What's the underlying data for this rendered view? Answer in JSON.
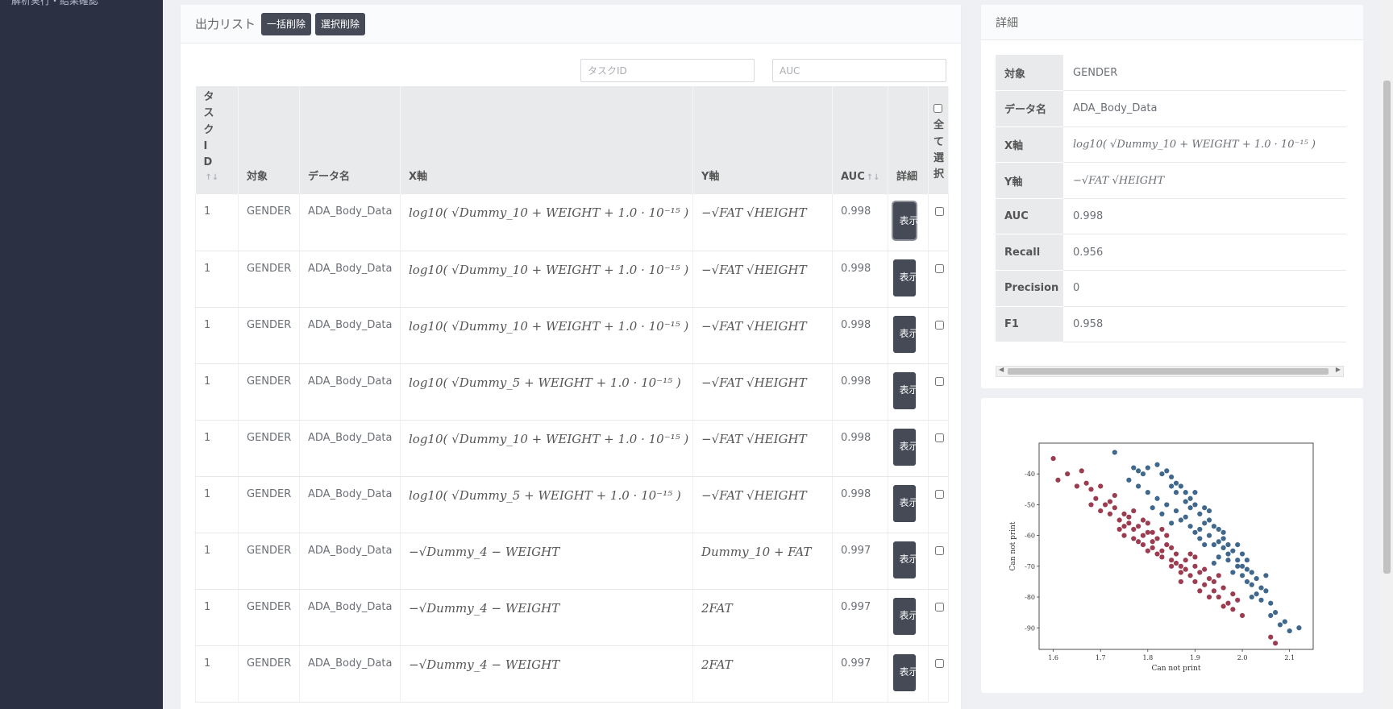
{
  "sidebar": {
    "item_label": "解析実行・結果確認"
  },
  "output_list": {
    "title": "出力リスト",
    "bulk_delete_label": "一括削除",
    "selected_delete_label": "選択削除",
    "filter_task_placeholder": "タスクID",
    "filter_auc_placeholder": "AUC",
    "columns": {
      "task_id": "タスクID",
      "target": "対象",
      "data_name": "データ名",
      "x_axis": "X軸",
      "y_axis": "Y軸",
      "auc": "AUC",
      "detail": "詳細",
      "select_all": "全て選択"
    },
    "sort_icon": "sort-arrows-icon",
    "show_label": "表示",
    "rows": [
      {
        "task_id": "1",
        "target": "GENDER",
        "data_name": "ADA_Body_Data",
        "x": "log10( √Dummy_10 + WEIGHT + 1.0 · 10⁻¹⁵ )",
        "y": "−√FAT √HEIGHT",
        "auc": "0.998"
      },
      {
        "task_id": "1",
        "target": "GENDER",
        "data_name": "ADA_Body_Data",
        "x": "log10( √Dummy_10 + WEIGHT + 1.0 · 10⁻¹⁵ )",
        "y": "−√FAT √HEIGHT",
        "auc": "0.998"
      },
      {
        "task_id": "1",
        "target": "GENDER",
        "data_name": "ADA_Body_Data",
        "x": "log10( √Dummy_10 + WEIGHT + 1.0 · 10⁻¹⁵ )",
        "y": "−√FAT √HEIGHT",
        "auc": "0.998"
      },
      {
        "task_id": "1",
        "target": "GENDER",
        "data_name": "ADA_Body_Data",
        "x": "log10( √Dummy_5 + WEIGHT + 1.0 · 10⁻¹⁵ )",
        "y": "−√FAT √HEIGHT",
        "auc": "0.998"
      },
      {
        "task_id": "1",
        "target": "GENDER",
        "data_name": "ADA_Body_Data",
        "x": "log10( √Dummy_10 + WEIGHT + 1.0 · 10⁻¹⁵ )",
        "y": "−√FAT √HEIGHT",
        "auc": "0.998"
      },
      {
        "task_id": "1",
        "target": "GENDER",
        "data_name": "ADA_Body_Data",
        "x": "log10( √Dummy_5 + WEIGHT + 1.0 · 10⁻¹⁵ )",
        "y": "−√FAT √HEIGHT",
        "auc": "0.998"
      },
      {
        "task_id": "1",
        "target": "GENDER",
        "data_name": "ADA_Body_Data",
        "x": "−√Dummy_4 − WEIGHT",
        "y": "Dummy_10 + FAT",
        "auc": "0.997"
      },
      {
        "task_id": "1",
        "target": "GENDER",
        "data_name": "ADA_Body_Data",
        "x": "−√Dummy_4 − WEIGHT",
        "y": "2FAT",
        "auc": "0.997"
      },
      {
        "task_id": "1",
        "target": "GENDER",
        "data_name": "ADA_Body_Data",
        "x": "−√Dummy_4 − WEIGHT",
        "y": "2FAT",
        "auc": "0.997"
      }
    ]
  },
  "detail": {
    "title": "詳細",
    "rows": [
      {
        "label": "対象",
        "value": "GENDER"
      },
      {
        "label": "データ名",
        "value": "ADA_Body_Data"
      },
      {
        "label": "X軸",
        "value": "log10( √Dummy_10 + WEIGHT + 1.0 · 10⁻¹⁵ )"
      },
      {
        "label": "Y軸",
        "value": "−√FAT √HEIGHT"
      },
      {
        "label": "AUC",
        "value": "0.998"
      },
      {
        "label": "Recall",
        "value": "0.956"
      },
      {
        "label": "Precision",
        "value": "0"
      },
      {
        "label": "F1",
        "value": "0.958"
      }
    ]
  },
  "chart_data": {
    "type": "scatter",
    "title": "",
    "xlabel": "Can not print",
    "ylabel": "Can not print",
    "xlim": [
      1.57,
      2.15
    ],
    "ylim": [
      -97,
      -30
    ],
    "xticks": [
      1.6,
      1.7,
      1.8,
      1.9,
      2.0,
      2.1
    ],
    "xtick_labels": [
      "1.6",
      "1.7",
      "1.8",
      "1.9",
      "2.0",
      "2.1"
    ],
    "yticks": [
      -40,
      -50,
      -60,
      -70,
      -80,
      -90
    ],
    "ytick_labels": [
      "-40",
      "-50",
      "-60",
      "-70",
      "-80",
      "-90"
    ],
    "grid": false,
    "legend": "none",
    "colors": {
      "class_a": "#1f4e79",
      "class_b": "#8b1a32"
    },
    "series": [
      {
        "color_key": "class_a",
        "points": [
          [
            1.73,
            -33
          ],
          [
            1.77,
            -38
          ],
          [
            1.79,
            -40
          ],
          [
            1.8,
            -38
          ],
          [
            1.82,
            -37
          ],
          [
            1.83,
            -40
          ],
          [
            1.84,
            -39
          ],
          [
            1.85,
            -41
          ],
          [
            1.85,
            -44
          ],
          [
            1.86,
            -46
          ],
          [
            1.87,
            -44
          ],
          [
            1.88,
            -46
          ],
          [
            1.88,
            -49
          ],
          [
            1.89,
            -48
          ],
          [
            1.9,
            -50
          ],
          [
            1.9,
            -46
          ],
          [
            1.91,
            -53
          ],
          [
            1.92,
            -51
          ],
          [
            1.92,
            -56
          ],
          [
            1.93,
            -55
          ],
          [
            1.94,
            -57
          ],
          [
            1.95,
            -58
          ],
          [
            1.95,
            -62
          ],
          [
            1.96,
            -61
          ],
          [
            1.97,
            -63
          ],
          [
            1.97,
            -66
          ],
          [
            1.98,
            -65
          ],
          [
            1.99,
            -68
          ],
          [
            2.0,
            -66
          ],
          [
            2.0,
            -70
          ],
          [
            2.01,
            -71
          ],
          [
            2.02,
            -72
          ],
          [
            2.02,
            -76
          ],
          [
            2.03,
            -74
          ],
          [
            2.04,
            -77
          ],
          [
            2.05,
            -78
          ],
          [
            2.06,
            -82
          ],
          [
            2.07,
            -85
          ],
          [
            2.08,
            -89
          ],
          [
            2.09,
            -88
          ],
          [
            2.1,
            -91
          ],
          [
            2.12,
            -90
          ],
          [
            1.76,
            -42
          ],
          [
            1.78,
            -44
          ],
          [
            1.8,
            -46
          ],
          [
            1.82,
            -48
          ],
          [
            1.84,
            -50
          ],
          [
            1.86,
            -52
          ],
          [
            1.87,
            -55
          ],
          [
            1.89,
            -57
          ],
          [
            1.9,
            -59
          ],
          [
            1.91,
            -61
          ],
          [
            1.93,
            -60
          ],
          [
            1.94,
            -63
          ],
          [
            1.96,
            -64
          ],
          [
            1.97,
            -68
          ],
          [
            1.99,
            -70
          ],
          [
            2.0,
            -73
          ],
          [
            2.01,
            -75
          ],
          [
            2.03,
            -79
          ],
          [
            1.81,
            -51
          ],
          [
            1.83,
            -53
          ],
          [
            1.85,
            -56
          ],
          [
            1.88,
            -54
          ],
          [
            1.91,
            -58
          ],
          [
            1.95,
            -67
          ],
          [
            1.98,
            -72
          ],
          [
            2.04,
            -81
          ],
          [
            1.78,
            -39
          ],
          [
            1.86,
            -43
          ],
          [
            1.93,
            -52
          ],
          [
            1.96,
            -59
          ],
          [
            1.99,
            -63
          ],
          [
            2.01,
            -68
          ],
          [
            2.05,
            -73
          ],
          [
            2.06,
            -86
          ],
          [
            1.89,
            -51
          ],
          [
            1.92,
            -63
          ],
          [
            1.94,
            -69
          ],
          [
            2.02,
            -80
          ]
        ]
      },
      {
        "color_key": "class_b",
        "points": [
          [
            1.6,
            -35
          ],
          [
            1.61,
            -42
          ],
          [
            1.66,
            -39
          ],
          [
            1.67,
            -43
          ],
          [
            1.68,
            -45
          ],
          [
            1.69,
            -48
          ],
          [
            1.7,
            -44
          ],
          [
            1.71,
            -50
          ],
          [
            1.72,
            -53
          ],
          [
            1.73,
            -51
          ],
          [
            1.74,
            -55
          ],
          [
            1.75,
            -53
          ],
          [
            1.75,
            -57
          ],
          [
            1.76,
            -56
          ],
          [
            1.77,
            -58
          ],
          [
            1.77,
            -61
          ],
          [
            1.78,
            -57
          ],
          [
            1.79,
            -60
          ],
          [
            1.79,
            -63
          ],
          [
            1.8,
            -59
          ],
          [
            1.81,
            -62
          ],
          [
            1.81,
            -64
          ],
          [
            1.82,
            -61
          ],
          [
            1.83,
            -65
          ],
          [
            1.83,
            -67
          ],
          [
            1.84,
            -63
          ],
          [
            1.85,
            -68
          ],
          [
            1.85,
            -70
          ],
          [
            1.86,
            -66
          ],
          [
            1.87,
            -70
          ],
          [
            1.87,
            -72
          ],
          [
            1.88,
            -68
          ],
          [
            1.89,
            -73
          ],
          [
            1.9,
            -70
          ],
          [
            1.9,
            -75
          ],
          [
            1.91,
            -72
          ],
          [
            1.92,
            -76
          ],
          [
            1.93,
            -74
          ],
          [
            1.94,
            -78
          ],
          [
            1.95,
            -80
          ],
          [
            1.96,
            -77
          ],
          [
            1.97,
            -82
          ],
          [
            1.98,
            -84
          ],
          [
            1.99,
            -81
          ],
          [
            2.0,
            -86
          ],
          [
            2.06,
            -93
          ],
          [
            2.07,
            -95
          ],
          [
            1.72,
            -49
          ],
          [
            1.74,
            -58
          ],
          [
            1.76,
            -54
          ],
          [
            1.78,
            -62
          ],
          [
            1.8,
            -56
          ],
          [
            1.82,
            -66
          ],
          [
            1.84,
            -60
          ],
          [
            1.86,
            -69
          ],
          [
            1.88,
            -71
          ],
          [
            1.9,
            -67
          ],
          [
            1.92,
            -71
          ],
          [
            1.94,
            -75
          ],
          [
            1.96,
            -83
          ],
          [
            1.7,
            -52
          ],
          [
            1.73,
            -47
          ],
          [
            1.77,
            -52
          ],
          [
            1.8,
            -65
          ],
          [
            1.83,
            -58
          ],
          [
            1.85,
            -64
          ],
          [
            1.89,
            -66
          ],
          [
            1.91,
            -78
          ],
          [
            1.95,
            -73
          ],
          [
            1.68,
            -50
          ],
          [
            1.75,
            -60
          ],
          [
            1.79,
            -55
          ],
          [
            1.81,
            -59
          ],
          [
            1.87,
            -75
          ],
          [
            1.93,
            -80
          ],
          [
            1.98,
            -79
          ],
          [
            1.63,
            -40
          ],
          [
            1.65,
            -44
          ]
        ]
      }
    ]
  }
}
